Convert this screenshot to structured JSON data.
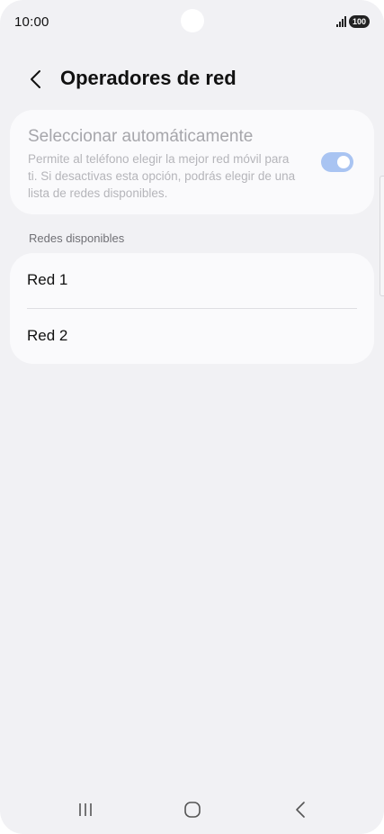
{
  "status_bar": {
    "time": "10:00",
    "battery": "100",
    "icons": [
      "signal-icon",
      "battery-icon"
    ]
  },
  "header": {
    "title": "Operadores de red",
    "back_icon": "chevron-left-icon"
  },
  "auto_select": {
    "title": "Seleccionar automáticamente",
    "description": "Permite al teléfono elegir la mejor red móvil para ti. Si desactivas esta opción, podrás elegir de una lista de redes disponibles.",
    "enabled": true,
    "toggle_color": "#a9c4f2"
  },
  "networks": {
    "section_label": "Redes disponibles",
    "items": [
      {
        "label": "Red 1"
      },
      {
        "label": "Red 2"
      }
    ]
  },
  "nav_bar": {
    "icons": [
      "recents-icon",
      "home-icon",
      "back-icon"
    ]
  }
}
